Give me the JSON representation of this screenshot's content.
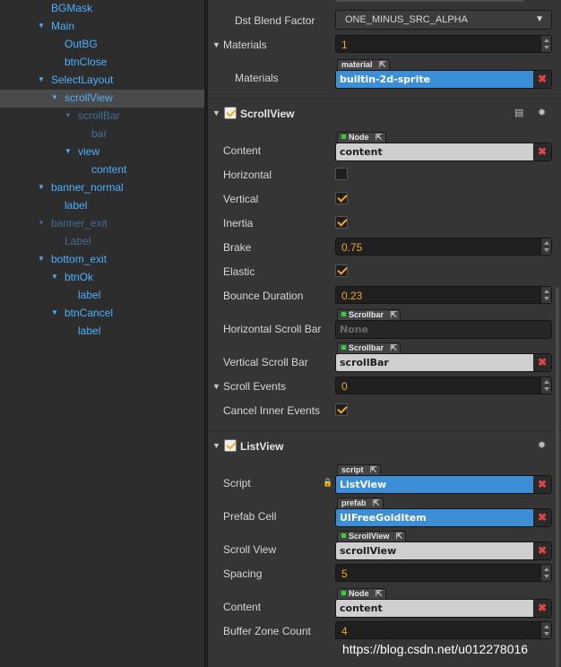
{
  "hierarchy": {
    "items": [
      {
        "label": "BGMask",
        "arrow": ""
      },
      {
        "label": "Main",
        "arrow": "▼"
      },
      {
        "label": "OutBG",
        "arrow": ""
      },
      {
        "label": "btnClose",
        "arrow": ""
      },
      {
        "label": "SelectLayout",
        "arrow": "▼"
      },
      {
        "label": "scrollView",
        "arrow": "▼"
      },
      {
        "label": "scrollBar",
        "arrow": "▼"
      },
      {
        "label": "bar",
        "arrow": ""
      },
      {
        "label": "view",
        "arrow": "▼"
      },
      {
        "label": "content",
        "arrow": ""
      },
      {
        "label": "banner_normal",
        "arrow": "▼"
      },
      {
        "label": "label",
        "arrow": ""
      },
      {
        "label": "banner_exit",
        "arrow": "▼"
      },
      {
        "label": "Label",
        "arrow": ""
      },
      {
        "label": "bottom_exit",
        "arrow": "▼"
      },
      {
        "label": "btnOk",
        "arrow": "▼"
      },
      {
        "label": "label",
        "arrow": ""
      },
      {
        "label": "btnCancel",
        "arrow": "▼"
      },
      {
        "label": "label",
        "arrow": ""
      }
    ]
  },
  "sprite": {
    "dst_blend_label": "Dst Blend Factor",
    "dst_blend_value": "ONE_MINUS_SRC_ALPHA",
    "materials_count_label": "Materials",
    "materials_count": "1",
    "materials_label": "Materials",
    "materials_tag": "material",
    "materials_value": "builtin-2d-sprite"
  },
  "scrollview": {
    "title": "ScrollView",
    "content_label": "Content",
    "content_tag": "Node",
    "content_value": "content",
    "horizontal_label": "Horizontal",
    "horizontal": false,
    "vertical_label": "Vertical",
    "vertical": true,
    "inertia_label": "Inertia",
    "inertia": true,
    "brake_label": "Brake",
    "brake": "0.75",
    "elastic_label": "Elastic",
    "elastic": true,
    "bounce_label": "Bounce Duration",
    "bounce": "0.23",
    "hscroll_label": "Horizontal Scroll Bar",
    "hscroll_tag": "Scrollbar",
    "hscroll_value": "None",
    "vscroll_label": "Vertical Scroll Bar",
    "vscroll_tag": "Scrollbar",
    "vscroll_value": "scrollBar",
    "events_label": "Scroll Events",
    "events": "0",
    "cancel_inner_label": "Cancel Inner Events",
    "cancel_inner": true
  },
  "listview": {
    "title": "ListView",
    "script_label": "Script",
    "script_tag": "script",
    "script_value": "ListView",
    "prefab_label": "Prefab Cell",
    "prefab_tag": "prefab",
    "prefab_value": "UIFreeGoldItem",
    "scrollview_label": "Scroll View",
    "scrollview_tag": "ScrollView",
    "scrollview_value": "scrollView",
    "spacing_label": "Spacing",
    "spacing": "5",
    "content_label": "Content",
    "content_tag": "Node",
    "content_value": "content",
    "buffer_label": "Buffer Zone Count",
    "buffer": "4"
  },
  "watermark": "https://blog.csdn.net/u012278016",
  "colors": {
    "accent": "#f5a623",
    "link": "#4fb0ff",
    "selected_asset": "#3c8fd6"
  }
}
